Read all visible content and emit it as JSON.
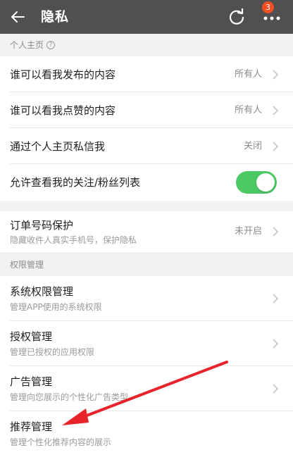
{
  "header": {
    "title": "隐私",
    "badge_count": "3",
    "back_icon": "arrow-left-icon",
    "refresh_icon": "refresh-icon",
    "more_icon": "more-dots-icon",
    "bg_color": "#505050",
    "badge_color": "#f04e23"
  },
  "personal": {
    "section_label": "个人主页",
    "help_glyph": "?",
    "rows": [
      {
        "label": "谁可以看我发布的内容",
        "value": "所有人"
      },
      {
        "label": "谁可以看我点赞的内容",
        "value": "所有人"
      },
      {
        "label": "通过个人主页私信我",
        "value": "关闭"
      },
      {
        "label": "允许查看我的关注/粉丝列表",
        "toggle_on": true
      }
    ]
  },
  "order": {
    "label": "订单号码保护",
    "sub": "隐藏收件人真实手机号，保护隐私",
    "value": "未开启"
  },
  "permissions": {
    "section_label": "权限管理",
    "rows": [
      {
        "label": "系统权限管理",
        "sub": "管理APP使用的系统权限"
      },
      {
        "label": "授权管理",
        "sub": "管理已授权的应用权限"
      },
      {
        "label": "广告管理",
        "sub": "管理向您展示的个性化广告类型"
      },
      {
        "label": "推荐管理",
        "sub": "管理个性化推荐内容的展示"
      }
    ]
  },
  "colors": {
    "toggle_on": "#4cc864",
    "annotation_arrow": "#e8242b"
  }
}
